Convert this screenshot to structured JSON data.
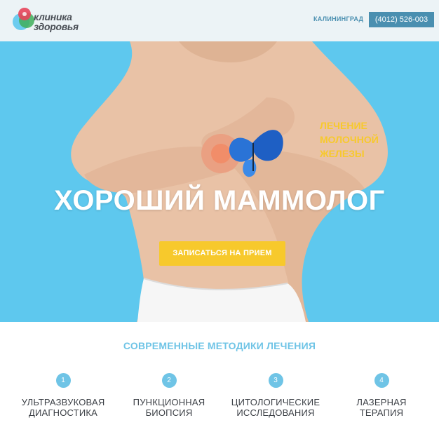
{
  "header": {
    "logo_line1": "клиника",
    "logo_line2": "здоровья",
    "city": "КАЛИНИНГРАД",
    "phone": "(4012) 526-003"
  },
  "hero": {
    "tag_line1": "ЛЕЧЕНИЕ",
    "tag_line2": "МОЛОЧНОЙ",
    "tag_line3": "ЖЕЛЕЗЫ",
    "title": "ХОРОШИЙ МАММОЛОГ",
    "cta": "ЗАПИСАТЬСЯ НА ПРИЕМ"
  },
  "methods": {
    "title": "СОВРЕМЕННЫЕ МЕТОДИКИ ЛЕЧЕНИЯ",
    "items": [
      {
        "num": "1",
        "label": "УЛЬТРАЗВУКОВАЯ\nДИАГНОСТИКА"
      },
      {
        "num": "2",
        "label": "ПУНКЦИОННАЯ\nБИОПСИЯ"
      },
      {
        "num": "3",
        "label": "ЦИТОЛОГИЧЕСКИЕ\nИССЛЕДОВАНИЯ"
      },
      {
        "num": "4",
        "label": "ЛАЗЕРНАЯ\nТЕРАПИЯ"
      }
    ]
  },
  "colors": {
    "hero_bg": "#5ec8ee",
    "accent_yellow": "#f7c92c",
    "accent_blue": "#6fc4e6",
    "phone_bg": "#4a8fb0"
  }
}
